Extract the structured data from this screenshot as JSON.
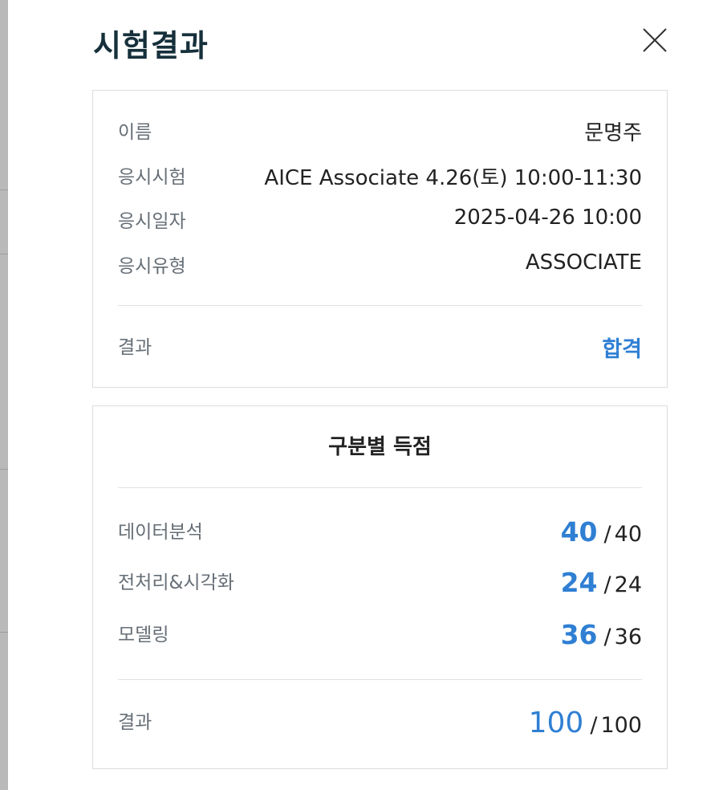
{
  "modal": {
    "title": "시험결과"
  },
  "icons": {
    "close": "close-icon"
  },
  "info": {
    "rows": [
      {
        "label": "이름",
        "value": "문명주"
      },
      {
        "label": "응시시험",
        "value": "AICE Associate 4.26(토) 10:00-11:30"
      },
      {
        "label": "응시일자",
        "value": "2025-04-26 10:00"
      },
      {
        "label": "응시유형",
        "value": "ASSOCIATE"
      }
    ],
    "result_label": "결과",
    "result_value": "합격"
  },
  "scores": {
    "title": "구분별 득점",
    "rows": [
      {
        "label": "데이터분석",
        "score": "40",
        "max": "40"
      },
      {
        "label": "전처리&시각화",
        "score": "24",
        "max": "24"
      },
      {
        "label": "모델링",
        "score": "36",
        "max": "36"
      }
    ],
    "total_label": "결과",
    "total_score": "100",
    "total_max": "100",
    "separator": "/"
  },
  "colors": {
    "accent": "#2f7fd3",
    "title": "#16303b",
    "label": "#666e76",
    "border": "#dcdcdc"
  }
}
